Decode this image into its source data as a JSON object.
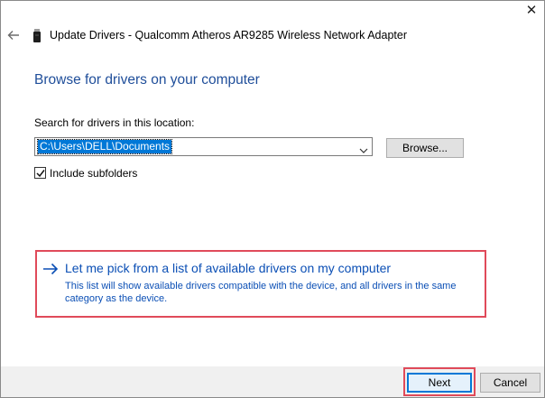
{
  "window": {
    "title": "Update Drivers - Qualcomm Atheros AR9285 Wireless Network Adapter",
    "close_glyph": "✕"
  },
  "page": {
    "heading": "Browse for drivers on your computer",
    "search_label": "Search for drivers in this location:",
    "location_value": "C:\\Users\\DELL\\Documents",
    "browse_label": "Browse...",
    "include_subfolders_label": "Include subfolders",
    "include_subfolders_checked": true
  },
  "pick_option": {
    "title": "Let me pick from a list of available drivers on my computer",
    "description": "This list will show available drivers compatible with the device, and all drivers in the same category as the device."
  },
  "footer": {
    "next_label": "Next",
    "cancel_label": "Cancel"
  },
  "icons": {
    "back": "back-arrow-icon",
    "device": "usb-adapter-icon",
    "dropdown": "chevron-down-icon",
    "check": "checkmark-icon",
    "option_arrow": "arrow-right-icon",
    "close": "close-icon"
  },
  "colors": {
    "heading": "#1f4e9a",
    "link": "#0b4fb5",
    "highlight": "#e04a5a",
    "selection": "#0078d7",
    "footer_bg": "#f0f0f0"
  }
}
